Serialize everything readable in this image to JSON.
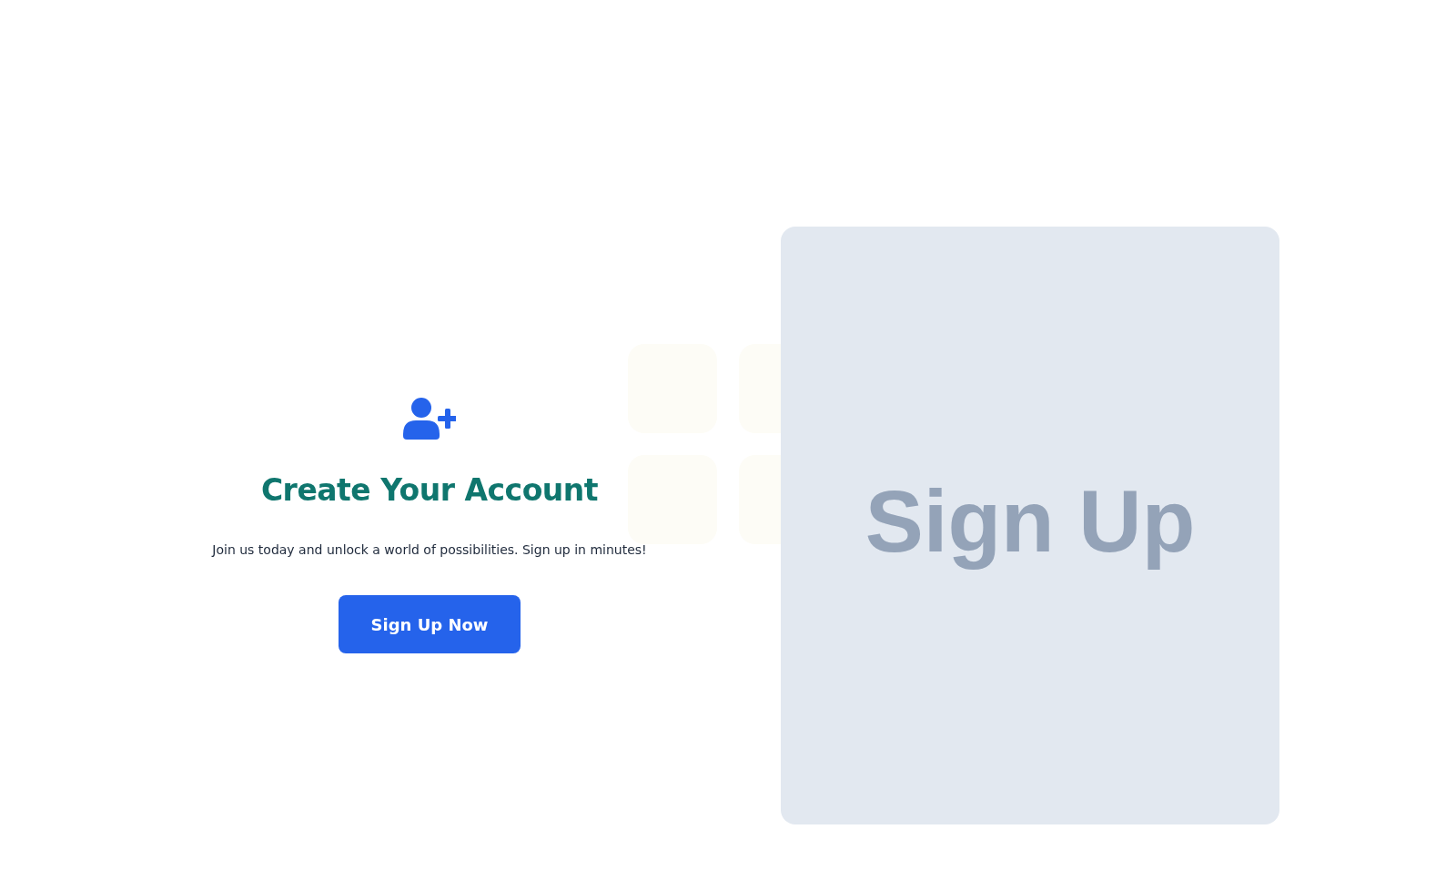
{
  "hero": {
    "title": "Create Your Account",
    "subtitle": "Join us today and unlock a world of possibilities. Sign up in minutes!",
    "button": "Sign Up Now"
  },
  "image_panel": {
    "text": "Sign Up"
  }
}
